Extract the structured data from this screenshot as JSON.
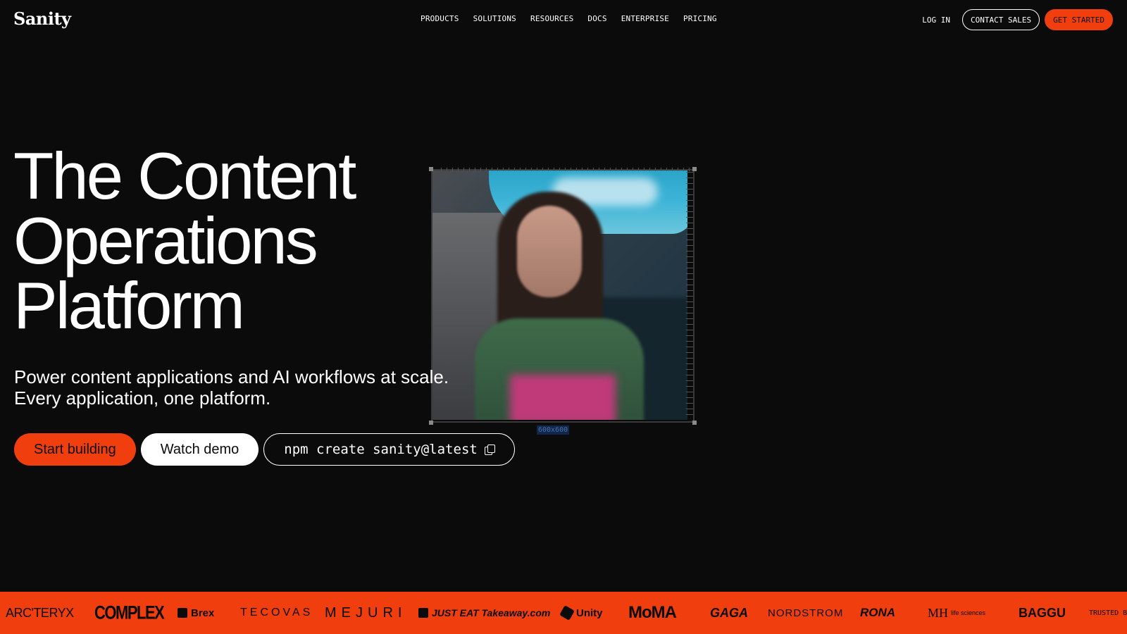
{
  "nav": {
    "logo": "Sanity",
    "links": [
      "PRODUCTS",
      "SOLUTIONS",
      "RESOURCES",
      "DOCS",
      "ENTERPRISE",
      "PRICING"
    ],
    "login": "LOG IN",
    "contact_sales": "CONTACT SALES",
    "get_started": "GET STARTED"
  },
  "hero": {
    "title_lines": [
      "The Content",
      "Operations",
      "Platform"
    ],
    "subtitle_lines": [
      "Power content applications and AI workflows at scale.",
      "Every application, one platform."
    ],
    "cta_primary": "Start building",
    "cta_secondary": "Watch demo",
    "cta_code": "npm create sanity@latest",
    "image_size_label": "600x600"
  },
  "logos": {
    "items": [
      "ARC'TERYX",
      "COMPLEX",
      "Brex",
      "TECOVAS",
      "MEJURI",
      "JUST EAT Takeaway.com",
      "Unity",
      "MoMA",
      "GAGA",
      "NORDSTROM",
      "RONA",
      "MH",
      "life sciences",
      "BAGGU",
      "TRUSTED B"
    ]
  },
  "colors": {
    "background": "#0b0b0b",
    "accent": "#f03e0f",
    "text": "#ffffff"
  },
  "icons": {
    "copy": "copy-icon"
  }
}
